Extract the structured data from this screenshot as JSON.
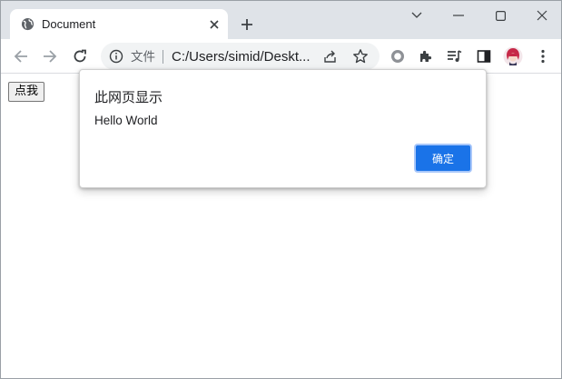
{
  "tab": {
    "title": "Document"
  },
  "omnibox": {
    "scheme_label": "文件",
    "url": "C:/Users/simid/Deskt..."
  },
  "page": {
    "button_label": "点我"
  },
  "dialog": {
    "title": "此网页显示",
    "message": "Hello World",
    "ok_label": "确定"
  },
  "colors": {
    "accent": "#1a73e8",
    "tabstrip": "#dfe3e8",
    "omnibox": "#f1f3f4"
  },
  "icons": {
    "favicon": "globe-icon",
    "tab_close": "close-icon",
    "new_tab": "plus-icon",
    "back": "arrow-left-icon",
    "forward": "arrow-right-icon",
    "reload": "reload-icon",
    "info": "info-icon",
    "share": "share-icon",
    "bookmark": "star-icon",
    "extension_circle": "circle-extension-icon",
    "extensions": "puzzle-icon",
    "reading_list": "reading-list-icon",
    "side_panel": "side-panel-icon",
    "profile": "avatar",
    "menu": "kebab-menu-icon"
  }
}
